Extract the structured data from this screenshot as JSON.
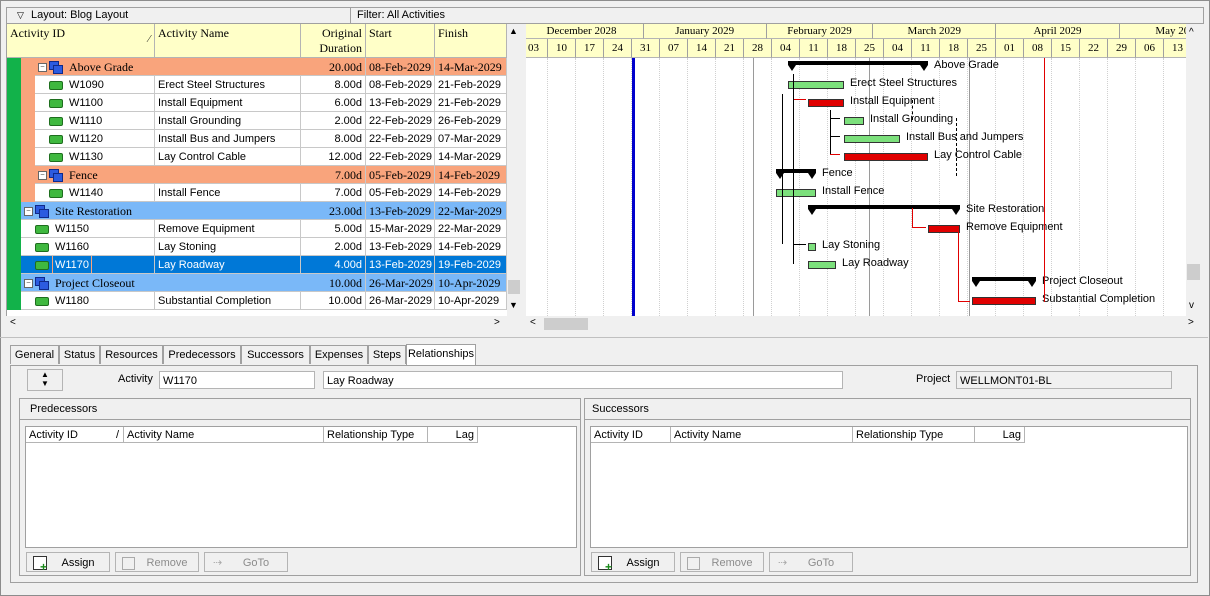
{
  "topbar": {
    "layout": "Layout: Blog Layout",
    "filter": "Filter: All Activities"
  },
  "columns": {
    "id": "Activity ID",
    "name": "Activity Name",
    "dur1": "Original",
    "dur2": "Duration",
    "start": "Start",
    "finish": "Finish"
  },
  "rows": [
    {
      "type": "wbs2",
      "id": "Above Grade",
      "dur": "20.00d",
      "start": "08-Feb-2029",
      "finish": "14-Mar-2029"
    },
    {
      "type": "task2",
      "id": "W1090",
      "name": "Erect Steel Structures",
      "dur": "8.00d",
      "start": "08-Feb-2029",
      "finish": "21-Feb-2029"
    },
    {
      "type": "task2",
      "id": "W1100",
      "name": "Install Equipment",
      "dur": "6.00d",
      "start": "13-Feb-2029",
      "finish": "21-Feb-2029"
    },
    {
      "type": "task2",
      "id": "W1110",
      "name": "Install Grounding",
      "dur": "2.00d",
      "start": "22-Feb-2029",
      "finish": "26-Feb-2029"
    },
    {
      "type": "task2",
      "id": "W1120",
      "name": "Install Bus and Jumpers",
      "dur": "8.00d",
      "start": "22-Feb-2029",
      "finish": "07-Mar-2029"
    },
    {
      "type": "task2",
      "id": "W1130",
      "name": "Lay Control Cable",
      "dur": "12.00d",
      "start": "22-Feb-2029",
      "finish": "14-Mar-2029"
    },
    {
      "type": "wbs2",
      "id": "Fence",
      "dur": "7.00d",
      "start": "05-Feb-2029",
      "finish": "14-Feb-2029"
    },
    {
      "type": "task2",
      "id": "W1140",
      "name": "Install Fence",
      "dur": "7.00d",
      "start": "05-Feb-2029",
      "finish": "14-Feb-2029"
    },
    {
      "type": "wbs1",
      "id": "Site Restoration",
      "dur": "23.00d",
      "start": "13-Feb-2029",
      "finish": "22-Mar-2029"
    },
    {
      "type": "task1",
      "id": "W1150",
      "name": "Remove Equipment",
      "dur": "5.00d",
      "start": "15-Mar-2029",
      "finish": "22-Mar-2029"
    },
    {
      "type": "task1",
      "id": "W1160",
      "name": "Lay Stoning",
      "dur": "2.00d",
      "start": "13-Feb-2029",
      "finish": "14-Feb-2029"
    },
    {
      "type": "task1",
      "id": "W1170",
      "name": "Lay Roadway",
      "dur": "4.00d",
      "start": "13-Feb-2029",
      "finish": "19-Feb-2029",
      "selected": true
    },
    {
      "type": "wbs1",
      "id": "Project Closeout",
      "dur": "10.00d",
      "start": "26-Mar-2029",
      "finish": "10-Apr-2029"
    },
    {
      "type": "task1",
      "id": "W1180",
      "name": "Substantial Completion",
      "dur": "10.00d",
      "start": "26-Mar-2029",
      "finish": "10-Apr-2029"
    }
  ],
  "gantt": {
    "months": [
      "December 2028",
      "January 2029",
      "February 2029",
      "March 2029",
      "April 2029",
      "May 20"
    ],
    "weeks": [
      "03",
      "10",
      "17",
      "24",
      "31",
      "07",
      "14",
      "21",
      "28",
      "04",
      "11",
      "18",
      "25",
      "04",
      "11",
      "18",
      "25",
      "01",
      "08",
      "15",
      "22",
      "29",
      "06",
      "13"
    ],
    "labels": [
      "Above Grade",
      "Erect Steel Structures",
      "Install Equipment",
      "Install Grounding",
      "Install Bus and Jumpers",
      "Lay Control Cable",
      "Fence",
      "Install Fence",
      "Site Restoration",
      "Remove Equipment",
      "Lay Stoning",
      "Lay Roadway",
      "Project Closeout",
      "Substantial Completion"
    ],
    "colors": {
      "noncritical": "#7ce07c",
      "critical": "#e00000",
      "datadate": "#0000cc"
    }
  },
  "tabs": [
    "General",
    "Status",
    "Resources",
    "Predecessors",
    "Successors",
    "Expenses",
    "Steps",
    "Relationships"
  ],
  "detail": {
    "activity_label": "Activity",
    "activity_id": "W1170",
    "activity_name": "Lay Roadway",
    "project_label": "Project",
    "project_value": "WELLMONT01-BL"
  },
  "pred": {
    "title": "Predecessors",
    "cols": [
      "Activity ID",
      "Activity Name",
      "Relationship Type",
      "Lag"
    ],
    "assign": "Assign",
    "remove": "Remove",
    "goto": "GoTo"
  },
  "succ": {
    "title": "Successors",
    "cols": [
      "Activity ID",
      "Activity Name",
      "Relationship Type",
      "Lag"
    ],
    "assign": "Assign",
    "remove": "Remove",
    "goto": "GoTo"
  }
}
